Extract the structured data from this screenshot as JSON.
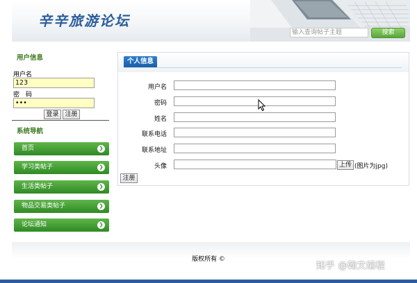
{
  "header": {
    "title": "辛辛旅游论坛",
    "search_placeholder": "输入查询帖子主题",
    "search_button": "搜索"
  },
  "sidebar": {
    "user_section_title": "用户信息",
    "username_label": "用户名",
    "username_value": "123",
    "password_label": "密　码",
    "password_value": "•••",
    "login_button": "登录",
    "register_button": "注册",
    "nav_section_title": "系统导航",
    "nav_items": [
      {
        "label": "首页",
        "icon": "chevron-right-icon"
      },
      {
        "label": "学习类帖子",
        "icon": "chevron-right-icon"
      },
      {
        "label": "生活类帖子",
        "icon": "chevron-right-icon"
      },
      {
        "label": "物品交易类帖子",
        "icon": "chevron-right-icon"
      },
      {
        "label": "论坛通知",
        "icon": "chevron-right-icon"
      }
    ]
  },
  "main": {
    "tab_label": "个人信息",
    "fields": [
      {
        "label": "用户名",
        "value": ""
      },
      {
        "label": "密码",
        "value": ""
      },
      {
        "label": "姓名",
        "value": ""
      },
      {
        "label": "联系电话",
        "value": ""
      },
      {
        "label": "联系地址",
        "value": ""
      },
      {
        "label": "头像",
        "value": ""
      }
    ],
    "upload_button": "上传",
    "upload_hint": "(图片为jpg)",
    "submit_button": "注册"
  },
  "footer": {
    "copyright": "版权所有 ©",
    "watermark": "知乎 @翰文编程"
  },
  "colors": {
    "brand_blue": "#2b5d9a",
    "nav_green": "#2f8a24",
    "tab_blue": "#1a5fa8",
    "input_yellow": "#ffffc4"
  }
}
